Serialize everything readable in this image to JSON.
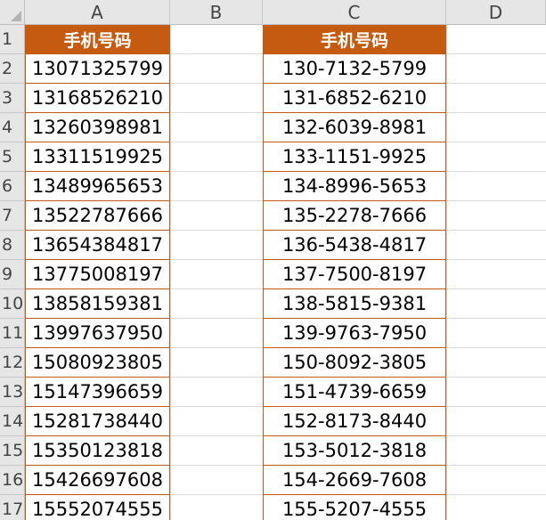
{
  "sheet": {
    "columns": [
      "A",
      "B",
      "C",
      "D"
    ],
    "rows": [
      "1",
      "2",
      "3",
      "4",
      "5",
      "6",
      "7",
      "8",
      "9",
      "10",
      "11",
      "12",
      "13",
      "14",
      "15",
      "16",
      "17"
    ]
  },
  "table_a": {
    "header": "手机号码",
    "values": [
      "13071325799",
      "13168526210",
      "13260398981",
      "13311519925",
      "13489965653",
      "13522787666",
      "13654384817",
      "13775008197",
      "13858159381",
      "13997637950",
      "15080923805",
      "15147396659",
      "15281738440",
      "15350123818",
      "15426697608",
      "15552074555"
    ]
  },
  "table_c": {
    "header": "手机号码",
    "values": [
      "130-7132-5799",
      "131-6852-6210",
      "132-6039-8981",
      "133-1151-9925",
      "134-8996-5653",
      "135-2278-7666",
      "136-5438-4817",
      "137-7500-8197",
      "138-5815-9381",
      "139-9763-7950",
      "150-8092-3805",
      "151-4739-6659",
      "152-8173-8440",
      "153-5012-3818",
      "154-2669-7608",
      "155-5207-4555"
    ]
  },
  "colors": {
    "header_fill": "#c55a11",
    "header_text": "#ffffff",
    "cell_border": "#c55a11",
    "gridline": "#dadada",
    "heading_bg": "#e6e6e6"
  }
}
